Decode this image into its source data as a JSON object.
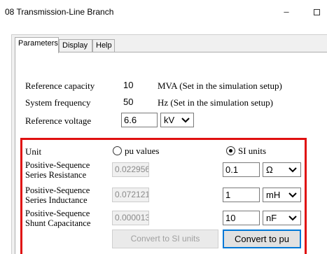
{
  "window": {
    "title": "08 Transmission-Line Branch",
    "minimize_glyph": "–"
  },
  "tabs": [
    {
      "label": "Parameters",
      "active": true
    },
    {
      "label": "Display",
      "active": false
    },
    {
      "label": "Help",
      "active": false
    }
  ],
  "params": {
    "ref_capacity": {
      "label": "Reference capacity",
      "value": "10",
      "note": "MVA (Set in the simulation setup)"
    },
    "sys_frequency": {
      "label": "System frequency",
      "value": "50",
      "note": "Hz (Set in the simulation setup)"
    },
    "ref_voltage": {
      "label": "Reference voltage",
      "value": "6.6",
      "unit": "kV"
    }
  },
  "unit": {
    "label": "Unit",
    "options": [
      {
        "label": "pu values",
        "selected": false
      },
      {
        "label": "SI units",
        "selected": true
      }
    ]
  },
  "rows": [
    {
      "label_line1": "Positive-Sequence",
      "label_line2": "Series Resistance",
      "pu_value": "0.022956",
      "si_value": "0.1",
      "unit": "Ω"
    },
    {
      "label_line1": "Positive-Sequence",
      "label_line2": "Series Inductance",
      "pu_value": "0.072121",
      "si_value": "1",
      "unit": "mH"
    },
    {
      "label_line1": "Positive-Sequence",
      "label_line2": "Shunt Capacitance",
      "pu_value": "0.000013",
      "si_value": "10",
      "unit": "nF"
    }
  ],
  "buttons": {
    "convert_si": "Convert to SI units",
    "convert_pu": "Convert to pu"
  },
  "colors": {
    "highlight_border": "#e01010",
    "default_button_border": "#0078d7"
  }
}
